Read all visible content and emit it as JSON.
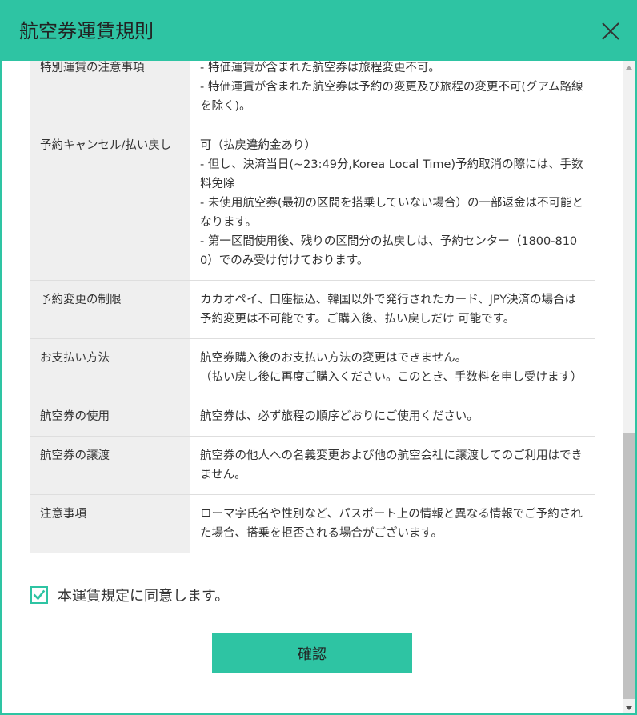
{
  "modal": {
    "title": "航空券運賃規則"
  },
  "rules": [
    {
      "label": "特別運賃の注意事項",
      "value": [
        "- 特価運賃が含まれた航空券は旅程変更不可。",
        "- 特価運賃が含まれた航空券は予約の変更及び旅程の変更不可(グアム路線を除く)。"
      ]
    },
    {
      "label": "予約キャンセル/払い戻し",
      "value": [
        "可（払戻違約金あり）",
        "- 但し、決済当日(~23:49分,Korea Local Time)予約取消の際には、手数料免除",
        "- 未使用航空券(最初の区間を搭乗していない場合）の一部返金は不可能となります。",
        "- 第一区間使用後、残りの区間分の払戻しは、予約センター（1800-8100）でのみ受け付けております。"
      ]
    },
    {
      "label": "予約変更の制限",
      "value": [
        "カカオペイ、口座振込、韓国以外で発行されたカード、JPY決済の場合は 予約変更は不可能です。ご購入後、払い戻しだけ 可能です。"
      ]
    },
    {
      "label": "お支払い方法",
      "value": [
        "航空券購入後のお支払い方法の変更はできません。",
        "（払い戻し後に再度ご購入ください。このとき、手数料を申し受けます）"
      ]
    },
    {
      "label": "航空券の使用",
      "value": [
        "航空券は、必ず旅程の順序どおりにご使用ください。"
      ]
    },
    {
      "label": "航空券の譲渡",
      "value": [
        "航空券の他人への名義変更および他の航空会社に譲渡してのご利用はできません。"
      ]
    },
    {
      "label": "注意事項",
      "value": [
        "ローマ字氏名や性別など、パスポート上の情報と異なる情報でご予約された場合、搭乗を拒否される場合がございます。"
      ]
    }
  ],
  "agreement": {
    "label": "本運賃規定に同意します。",
    "checked": true
  },
  "confirm_button": {
    "label": "確認"
  },
  "colors": {
    "accent": "#2ec4a3",
    "label_bg": "#efefef"
  },
  "icons": {
    "close": "close-icon",
    "check": "checkmark-icon"
  }
}
